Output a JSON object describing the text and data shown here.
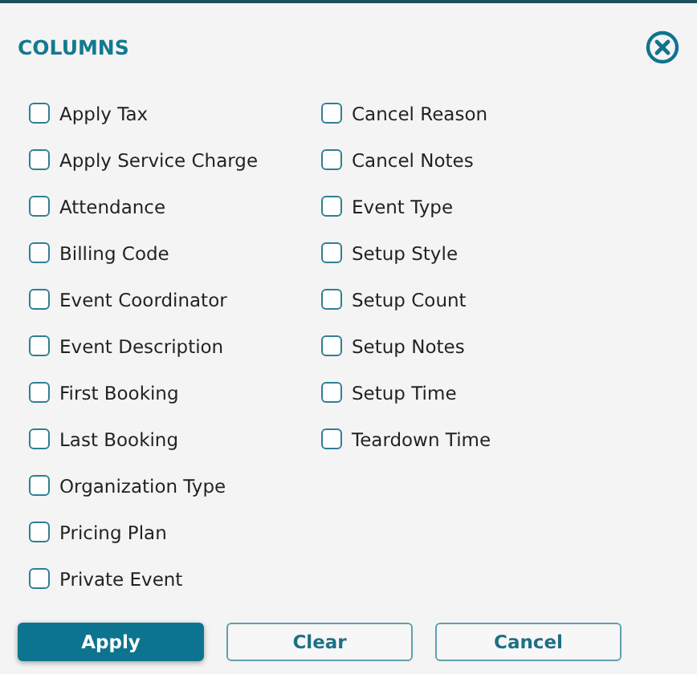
{
  "dialog": {
    "title": "COLUMNS"
  },
  "columns": [
    [
      {
        "label": "Apply Tax",
        "checked": false
      },
      {
        "label": "Apply Service Charge",
        "checked": false
      },
      {
        "label": "Attendance",
        "checked": false
      },
      {
        "label": "Billing Code",
        "checked": false
      },
      {
        "label": "Event Coordinator",
        "checked": false
      },
      {
        "label": "Event Description",
        "checked": false
      },
      {
        "label": "First Booking",
        "checked": false
      },
      {
        "label": "Last Booking",
        "checked": false
      },
      {
        "label": "Organization Type",
        "checked": false
      },
      {
        "label": "Pricing Plan",
        "checked": false
      },
      {
        "label": "Private Event",
        "checked": false
      }
    ],
    [
      {
        "label": "Cancel Reason",
        "checked": false
      },
      {
        "label": "Cancel Notes",
        "checked": false
      },
      {
        "label": "Event Type",
        "checked": false
      },
      {
        "label": "Setup Style",
        "checked": false
      },
      {
        "label": "Setup Count",
        "checked": false
      },
      {
        "label": "Setup Notes",
        "checked": false
      },
      {
        "label": "Setup Time",
        "checked": false
      },
      {
        "label": "Teardown Time",
        "checked": false
      }
    ]
  ],
  "buttons": [
    {
      "label": "Apply",
      "kind": "primary"
    },
    {
      "label": "Clear",
      "kind": "secondary"
    },
    {
      "label": "Cancel",
      "kind": "secondary"
    }
  ]
}
